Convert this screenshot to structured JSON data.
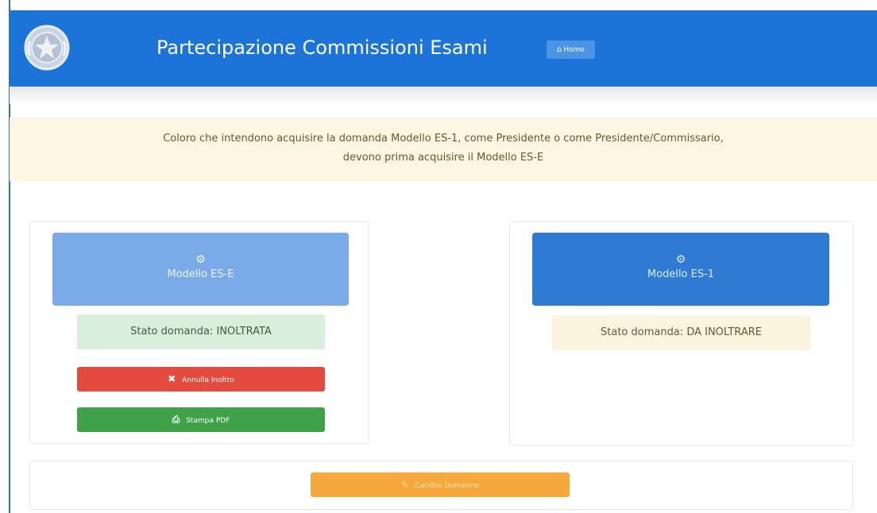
{
  "header": {
    "title": "Partecipazione Commissioni Esami",
    "home_label": "Home",
    "home_icon": "home-icon",
    "logo": "emblem-italian-republic"
  },
  "notice": {
    "line1": "Coloro che intendono acquisire la domanda Modello ES-1, come Presidente o come Presidente/Commissario,",
    "line2": "devono prima acquisire il Modello ES-E"
  },
  "cards": [
    {
      "label": "Modello ES-E",
      "icon": "gears-icon",
      "status": "Stato domanda: INOLTRATA",
      "actions": [
        {
          "label": "Annulla Inoltro",
          "icon": "close-icon",
          "color": "#e34b3f"
        },
        {
          "label": "Stampa PDF",
          "icon": "print-icon",
          "color": "#3fa148"
        }
      ]
    },
    {
      "label": "Modello ES-1",
      "icon": "gears-icon",
      "status": "Stato domanda: DA INOLTRARE"
    }
  ],
  "footer": {
    "button_label": "Cambio Domanne",
    "button_icon": "document-icon"
  },
  "colors": {
    "header": "#1d74d8",
    "card_es_e": "#7aaae8",
    "card_es_1": "#2f7bd4",
    "status_sent": "#d9eedb",
    "status_pending": "#fdf4e0",
    "notice_bg": "#fdf6e3",
    "footer_button": "#f6a83a"
  }
}
